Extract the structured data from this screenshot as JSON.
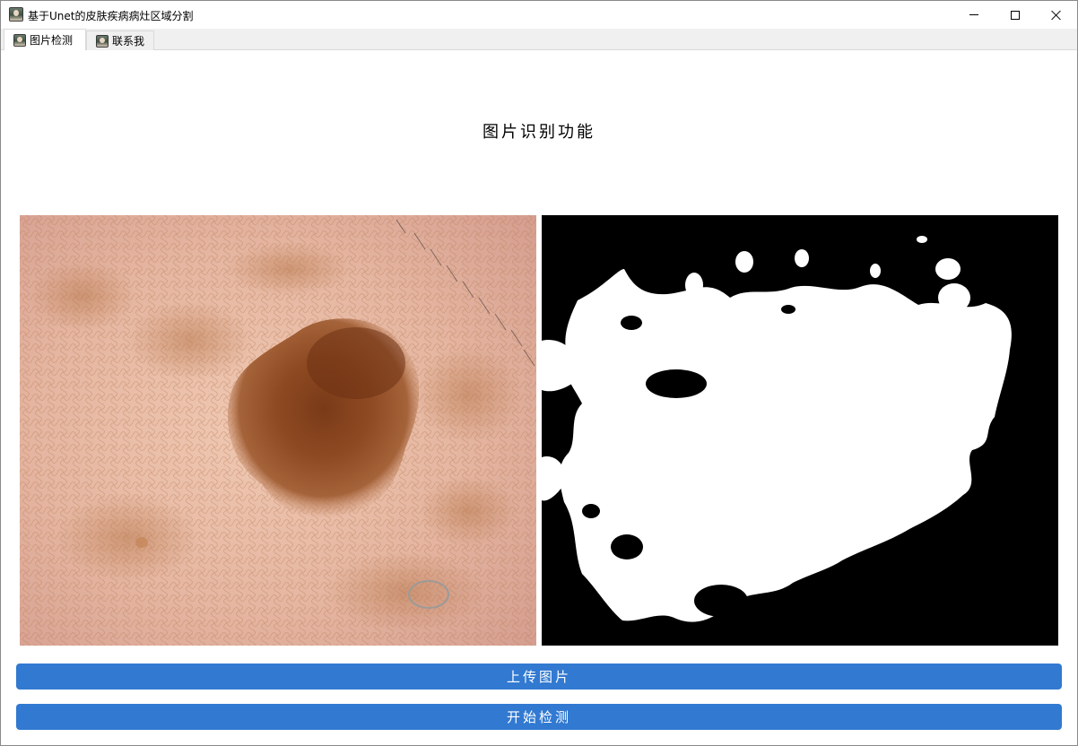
{
  "window": {
    "title": "基于Unet的皮肤疾病病灶区域分割",
    "icon": "app-photo-icon",
    "controls": [
      "minimize-icon",
      "maximize-icon",
      "close-icon"
    ]
  },
  "tabs": [
    {
      "label": "图片检测",
      "icon": "portrait-icon",
      "active": true
    },
    {
      "label": "联系我",
      "icon": "portrait-icon",
      "active": false
    }
  ],
  "main": {
    "heading": "图片识别功能",
    "input_image": "dermoscopy-skin-lesion-image",
    "output_image": "binary-segmentation-mask"
  },
  "buttons": {
    "upload_label": "上传图片",
    "detect_label": "开始检测"
  },
  "colors": {
    "button_bg": "#3179d1",
    "button_text": "#ffffff",
    "mask_background": "#000000",
    "mask_foreground": "#ffffff"
  }
}
